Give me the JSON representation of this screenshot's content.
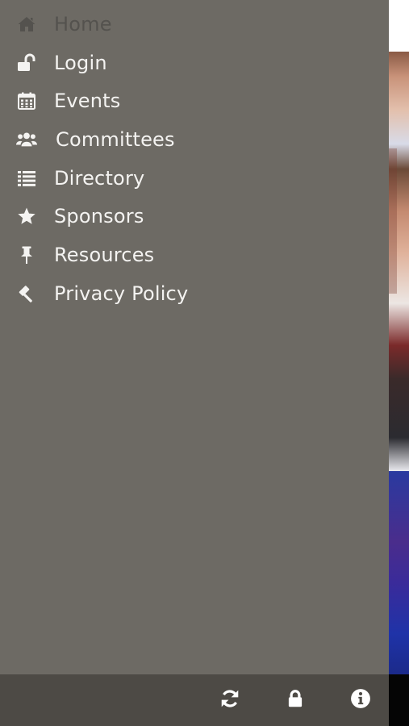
{
  "drawer": {
    "background_color": "#6d6a64",
    "active_color": "#54524e",
    "text_color": "#f4f3f1",
    "items": [
      {
        "label": "Home",
        "icon": "home-icon",
        "active": true
      },
      {
        "label": "Login",
        "icon": "unlock-icon",
        "active": false
      },
      {
        "label": "Events",
        "icon": "calendar-icon",
        "active": false
      },
      {
        "label": "Committees",
        "icon": "users-icon",
        "active": false
      },
      {
        "label": "Directory",
        "icon": "list-icon",
        "active": false
      },
      {
        "label": "Sponsors",
        "icon": "star-icon",
        "active": false
      },
      {
        "label": "Resources",
        "icon": "pushpin-icon",
        "active": false
      },
      {
        "label": "Privacy Policy",
        "icon": "gavel-icon",
        "active": false
      }
    ]
  },
  "toolbar": {
    "background_color": "#4d4a45",
    "buttons": [
      {
        "icon": "refresh-icon"
      },
      {
        "icon": "lock-icon"
      },
      {
        "icon": "info-icon"
      }
    ]
  }
}
